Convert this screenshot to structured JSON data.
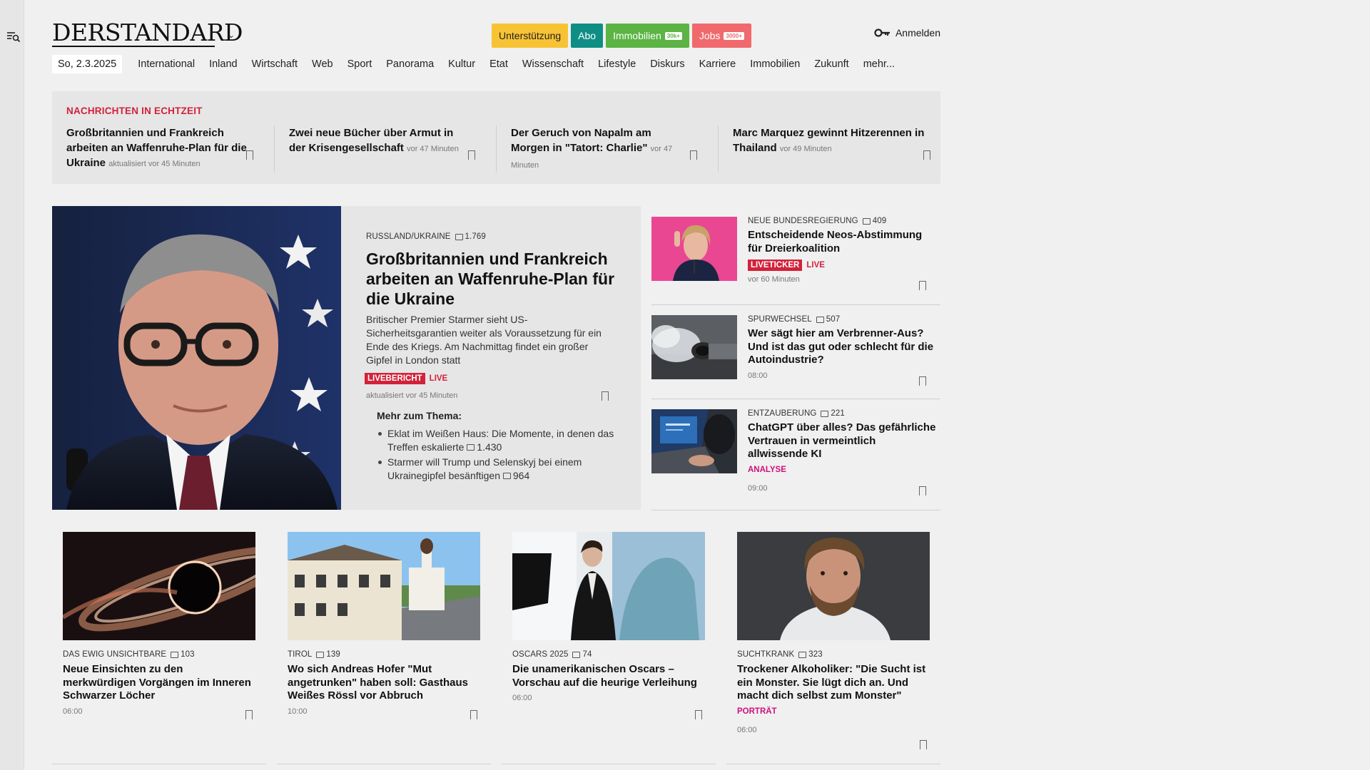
{
  "header": {
    "logo": "DERSTANDARD",
    "pills": {
      "support": "Unterstützung",
      "abo": "Abo",
      "immo": "Immobilien",
      "immo_badge": "30k+",
      "jobs": "Jobs",
      "jobs_badge": "3000+"
    },
    "login": "Anmelden"
  },
  "nav": {
    "date": "So, 2.3.2025",
    "items": [
      "International",
      "Inland",
      "Wirtschaft",
      "Web",
      "Sport",
      "Panorama",
      "Kultur",
      "Etat",
      "Wissenschaft",
      "Lifestyle",
      "Diskurs",
      "Karriere",
      "Immobilien",
      "Zukunft",
      "mehr..."
    ]
  },
  "ticker": {
    "title": "NACHRICHTEN IN ECHTZEIT",
    "items": [
      {
        "headline": "Großbritannien und Frankreich arbeiten an Waffenruhe-Plan für die Ukraine",
        "time": "aktualisiert vor 45 Minuten"
      },
      {
        "headline": "Zwei neue Bücher über Armut in der Krisengesellschaft",
        "time": "vor 47 Minuten"
      },
      {
        "headline": "Der Geruch von Napalm am Morgen in \"Tatort: Charlie\"",
        "time": "vor 47 Minuten"
      },
      {
        "headline": "Marc Marquez gewinnt Hitzerennen in Thailand",
        "time": "vor 49 Minuten"
      }
    ]
  },
  "lead": {
    "kicker": "RUSSLAND/UKRAINE",
    "comments": "1.769",
    "title": "Großbritannien und Frankreich arbeiten an Waffenruhe-Plan für die Ukraine",
    "text": "Britischer Premier Starmer sieht US-Sicherheitsgarantien weiter als Voraussetzung für ein Ende des Kriegs. Am Nachmittag findet ein großer Gipfel in London statt",
    "tag": "LIVEBERICHT",
    "live": "LIVE",
    "updated": "aktualisiert vor 45 Minuten",
    "more_title": "Mehr zum Thema:",
    "more": [
      {
        "text": "Eklat im Weißen Haus: Die Momente, in denen das Treffen eskalierte",
        "comments": "1.430"
      },
      {
        "text": "Starmer will Trump und Selenskyj bei einem Ukrainegipfel besänftigen",
        "comments": "964"
      }
    ]
  },
  "side": [
    {
      "kicker": "NEUE BUNDESREGIERUNG",
      "comments": "409",
      "title": "Entscheidende Neos-Abstimmung für Dreierkoalition",
      "tag": "LIVETICKER",
      "live": "LIVE",
      "meta": "vor 60 Minuten"
    },
    {
      "kicker": "SPURWECHSEL",
      "comments": "507",
      "title": "Wer sägt hier am Verbrenner-Aus? Und ist das gut oder schlecht für die Autoindustrie?",
      "meta": "08:00"
    },
    {
      "kicker": "ENTZAUBERUNG",
      "comments": "221",
      "title": "ChatGPT über alles? Das gefährliche Vertrauen in vermeintlich allwissende KI",
      "tag": "ANALYSE",
      "meta": "09:00"
    }
  ],
  "cards": [
    {
      "kicker": "DAS EWIG UNSICHTBARE",
      "comments": "103",
      "title": "Neue Einsichten zu den merkwürdigen Vorgängen im Inneren Schwarzer Löcher",
      "meta": "06:00"
    },
    {
      "kicker": "TIROL",
      "comments": "139",
      "title": "Wo sich Andreas Hofer \"Mut angetrunken\" haben soll: Gasthaus Weißes Rössl vor Abbruch",
      "meta": "10:00"
    },
    {
      "kicker": "OSCARS 2025",
      "comments": "74",
      "title": "Die unamerikanischen Oscars – Vorschau auf die heurige Verleihung",
      "meta": "06:00"
    },
    {
      "kicker": "SUCHTKRANK",
      "comments": "323",
      "title": "Trockener Alkoholiker: \"Die Sucht ist ein Monster. Sie lügt dich an. Und macht dich selbst zum Monster\"",
      "tag": "PORTRÄT",
      "meta": "06:00"
    }
  ],
  "icons": {
    "menu": "menu-search-icon",
    "login": "key-icon",
    "bookmark": "bookmark-icon",
    "comments": "comment-icon"
  },
  "colors": {
    "live_red": "#d2223a",
    "magenta": "#d10f7d",
    "support": "#f7c334",
    "abo": "#0f8e86",
    "immo": "#5bb443",
    "jobs": "#f0696c"
  }
}
